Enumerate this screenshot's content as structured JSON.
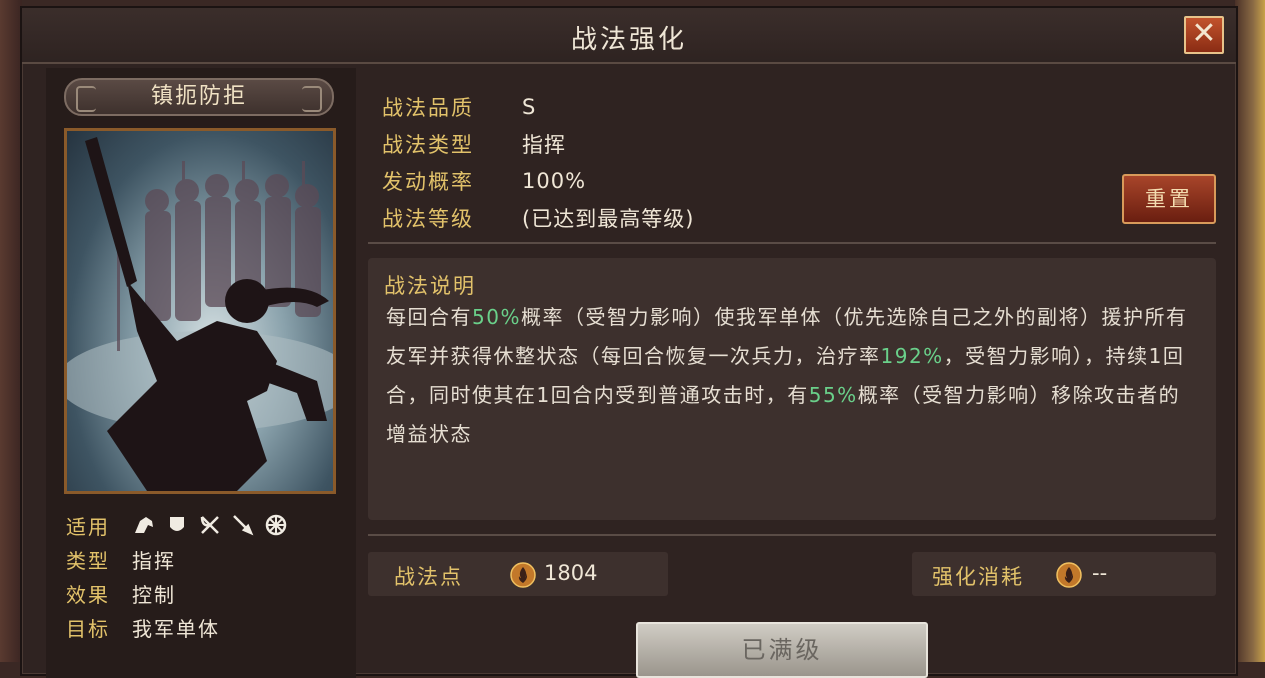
{
  "window": {
    "title": "战法强化",
    "close_label": "✕"
  },
  "skill": {
    "name": "镇扼防拒",
    "applicable_label": "适用",
    "applicable_icons": [
      "cavalry-icon",
      "shield-icon",
      "archer-icon",
      "spear-icon",
      "siege-icon"
    ],
    "info": [
      {
        "label": "类型",
        "value": "指挥"
      },
      {
        "label": "效果",
        "value": "控制"
      },
      {
        "label": "目标",
        "value": "我军单体"
      }
    ]
  },
  "attributes": [
    {
      "label": "战法品质",
      "value": "S"
    },
    {
      "label": "战法类型",
      "value": "指挥"
    },
    {
      "label": "发动概率",
      "value": "100%"
    },
    {
      "label": "战法等级",
      "value": "(已达到最高等级)"
    }
  ],
  "reset_label": "重置",
  "description": {
    "title": "战法说明",
    "p1": "每回合有",
    "v1": "50%",
    "p2": "概率（受智力影响）使我军单体（优先选除自己之外的副将）援护所有友军并获得休整状态（每回合恢复一次兵力，治疗率",
    "v2": "192%",
    "p3": "，受智力影响），持续1回合，同时使其在1回合内受到普通攻击时，有",
    "v3": "55%",
    "p4": "概率（受智力影响）移除攻击者的增益状态"
  },
  "points": {
    "label": "战法点",
    "value": "1804"
  },
  "cost": {
    "label": "强化消耗",
    "value": "--"
  },
  "max_label": "已满级",
  "colors": {
    "accent_gold": "#e2c26a",
    "highlight_green": "#6ad08a",
    "button_red": "#a8452a"
  }
}
